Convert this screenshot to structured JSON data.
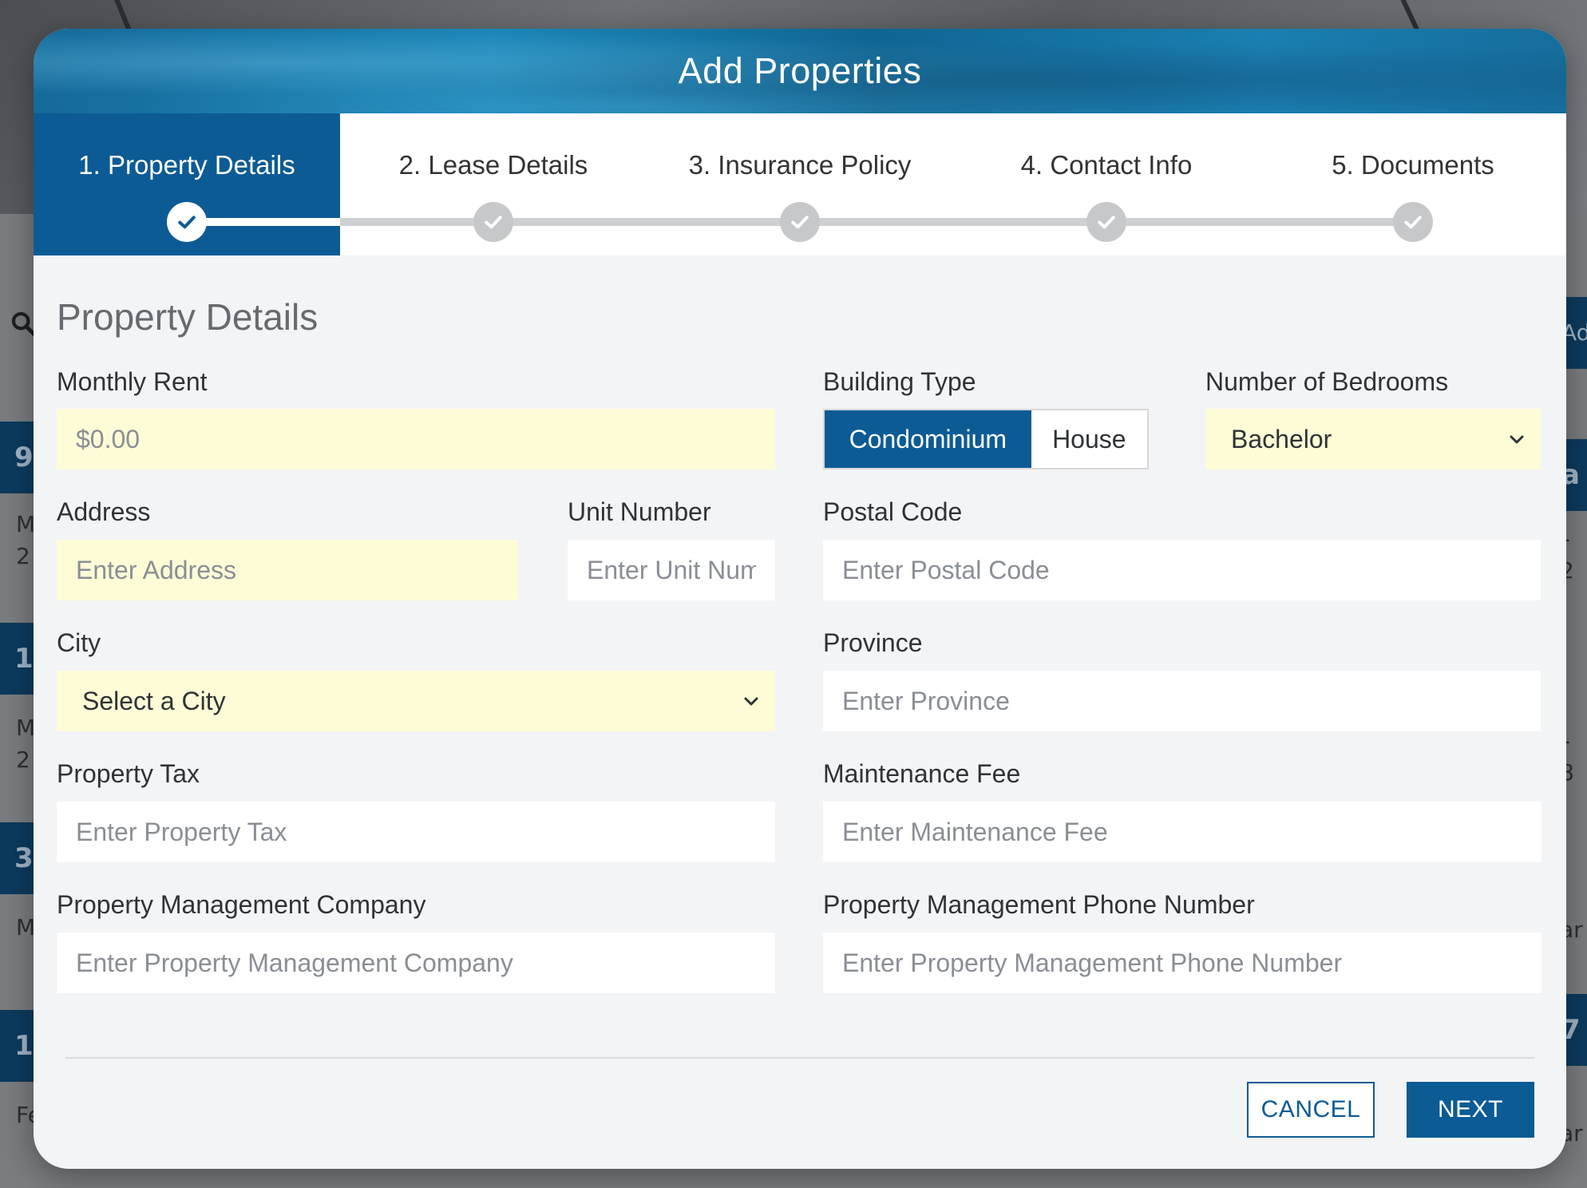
{
  "background": {
    "bars": [
      "9",
      "1",
      "3",
      "1"
    ],
    "rows": [
      "M",
      "2",
      "M",
      "2",
      "M",
      "Fe"
    ],
    "right_fragments": [
      "Ad",
      "a",
      "r 2",
      "r 8",
      "ar",
      "7",
      "ar"
    ]
  },
  "modal": {
    "title": "Add Properties",
    "steps": [
      {
        "label": "1. Property Details",
        "active": true
      },
      {
        "label": "2. Lease Details",
        "active": false
      },
      {
        "label": "3. Insurance Policy",
        "active": false
      },
      {
        "label": "4. Contact Info",
        "active": false
      },
      {
        "label": "5. Documents",
        "active": false
      }
    ],
    "section_title": "Property Details",
    "fields": {
      "monthly_rent": {
        "label": "Monthly Rent",
        "placeholder": "$0.00"
      },
      "building_type": {
        "label": "Building Type",
        "options": [
          "Condominium",
          "House"
        ],
        "selected": "Condominium"
      },
      "bedrooms": {
        "label": "Number of Bedrooms",
        "value": "Bachelor"
      },
      "address": {
        "label": "Address",
        "placeholder": "Enter Address"
      },
      "unit_number": {
        "label": "Unit Number",
        "placeholder": "Enter Unit Number"
      },
      "postal_code": {
        "label": "Postal Code",
        "placeholder": "Enter Postal Code"
      },
      "city": {
        "label": "City",
        "value": "Select a City"
      },
      "province": {
        "label": "Province",
        "placeholder": "Enter Province"
      },
      "property_tax": {
        "label": "Property Tax",
        "placeholder": "Enter Property Tax"
      },
      "maintenance_fee": {
        "label": "Maintenance Fee",
        "placeholder": "Enter Maintenance Fee"
      },
      "pm_company": {
        "label": "Property Management Company",
        "placeholder": "Enter Property Management Company"
      },
      "pm_phone": {
        "label": "Property Management Phone Number",
        "placeholder": "Enter Property Management Phone Number"
      }
    },
    "buttons": {
      "cancel": "CANCEL",
      "next": "NEXT"
    }
  },
  "colors": {
    "primary": "#0c5b95",
    "required_field": "#fefcd7",
    "step_inactive": "#c7c8ca"
  }
}
